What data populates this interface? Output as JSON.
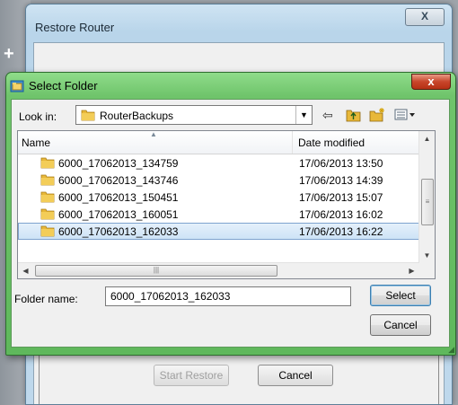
{
  "background_window": {
    "title": "Restore Router",
    "close_glyph": "X",
    "start_restore_label": "Start Restore",
    "cancel_label": "Cancel"
  },
  "dialog": {
    "title": "Select Folder",
    "close_glyph": "x",
    "look_in_label": "Look in:",
    "look_in_value": "RouterBackups",
    "columns": {
      "name": "Name",
      "date": "Date modified"
    },
    "rows": [
      {
        "name": "6000_17062013_134759",
        "date": "17/06/2013 13:50",
        "selected": false
      },
      {
        "name": "6000_17062013_143746",
        "date": "17/06/2013 14:39",
        "selected": false
      },
      {
        "name": "6000_17062013_150451",
        "date": "17/06/2013 15:07",
        "selected": false
      },
      {
        "name": "6000_17062013_160051",
        "date": "17/06/2013 16:02",
        "selected": false
      },
      {
        "name": "6000_17062013_162033",
        "date": "17/06/2013 16:22",
        "selected": true
      }
    ],
    "folder_name_label": "Folder name:",
    "folder_name_value": "6000_17062013_162033",
    "select_label": "Select",
    "cancel_label": "Cancel",
    "toolbar_icons": [
      "back-arrow-icon",
      "up-folder-icon",
      "new-folder-icon",
      "views-menu-icon"
    ]
  },
  "colors": {
    "dialog_frame": "#6fc46b",
    "selection": "#cce2f6",
    "folder": "#e8b83a"
  }
}
